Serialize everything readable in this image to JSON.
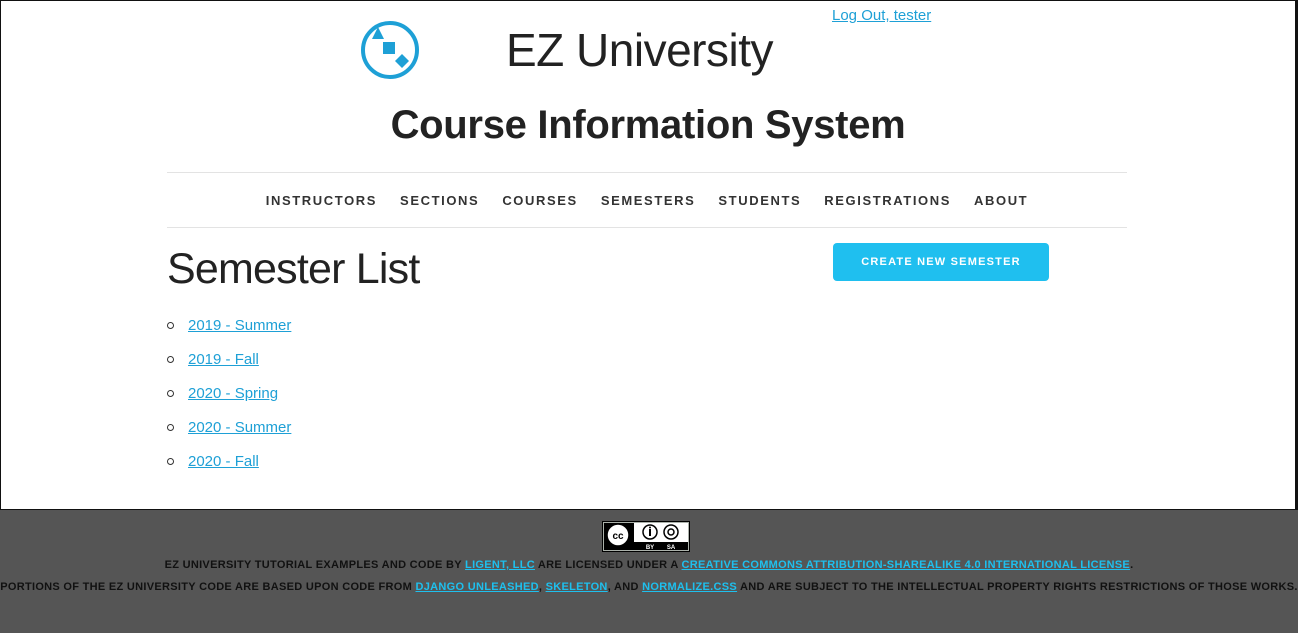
{
  "header": {
    "site_title": "EZ University",
    "subtitle": "Course Information System",
    "logout_label": "Log Out, tester"
  },
  "nav": {
    "items": [
      {
        "label": "INSTRUCTORS"
      },
      {
        "label": "SECTIONS"
      },
      {
        "label": "COURSES"
      },
      {
        "label": "SEMESTERS"
      },
      {
        "label": "STUDENTS"
      },
      {
        "label": "REGISTRATIONS"
      },
      {
        "label": "ABOUT"
      }
    ]
  },
  "main": {
    "heading": "Semester List",
    "create_button_label": "CREATE NEW SEMESTER",
    "semesters": [
      {
        "label": "2019 - Summer"
      },
      {
        "label": "2019 - Fall"
      },
      {
        "label": "2020 - Spring"
      },
      {
        "label": "2020 - Summer"
      },
      {
        "label": "2020 - Fall"
      }
    ]
  },
  "footer": {
    "badge_by": "BY",
    "badge_sa": "SA",
    "line1_prefix": "EZ University Tutorial Examples and Code by",
    "line1_author": "Ligent, LLC",
    "line1_middle": "are licensed under a",
    "line1_license": "Creative Commons Attribution-ShareAlike 4.0 International License",
    "line1_suffix": ".",
    "line2_prefix": "Portions of the EZ University code are based upon code from",
    "line2_link1": "Django Unleashed",
    "line2_sep1": ",",
    "line2_link2": "Skeleton",
    "line2_sep2": ", and",
    "line2_link3": "Normalize.css",
    "line2_suffix": "and are subject to the intellectual property rights restrictions of those works."
  },
  "colors": {
    "accent": "#1fbfef",
    "link": "#1ea0d6",
    "footer_bg": "#555555"
  }
}
